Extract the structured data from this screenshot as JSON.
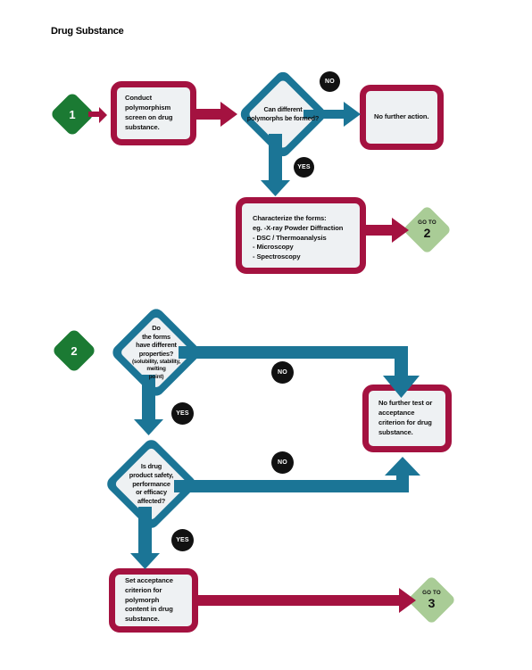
{
  "page": {
    "title": "Drug Substance",
    "colors": {
      "red": "#a41240",
      "teal": "#1b7596",
      "green": "#1b7a33",
      "light_green": "#a9cc96",
      "box_fill": "#eef1f3",
      "badge": "#111111"
    }
  },
  "section1": {
    "step_number": "1",
    "start_box": "Conduct polymorphism screen on drug substance.",
    "decision": "Can different polymorphs be formed?",
    "branch_no": "NO",
    "branch_yes": "YES",
    "no_result": "No further action.",
    "characterize": {
      "heading": "Characterize the forms:",
      "line1": "eg. -X-ray Powder Diffraction",
      "line2": "- DSC / Thermoanalysis",
      "line3": "- Microscopy",
      "line4": "- Spectroscopy"
    },
    "goto": {
      "label": "GO TO",
      "number": "2"
    }
  },
  "section2": {
    "step_number": "2",
    "decision1": "Do the forms have different properties? (solubility, stability, melting point)",
    "decision1_lines": {
      "l1": "Do",
      "l2": "the forms",
      "l3": "have different",
      "l4": "properties?",
      "l5": "(solubility, stability,",
      "l6": "melting",
      "l7": "point)"
    },
    "decision1_no": "NO",
    "decision1_yes": "YES",
    "decision2": "Is drug product safety, performance or efficacy affected?",
    "decision2_lines": {
      "l1": "Is drug",
      "l2": "product safety,",
      "l3": "performance",
      "l4": "or efficacy",
      "l5": "affected?"
    },
    "decision2_no": "NO",
    "decision2_yes": "YES",
    "no_result": "No further test or acceptance criterion for drug substance.",
    "final_box": "Set acceptance criterion for polymorph content in drug substance.",
    "goto": {
      "label": "GO TO",
      "number": "3"
    }
  }
}
